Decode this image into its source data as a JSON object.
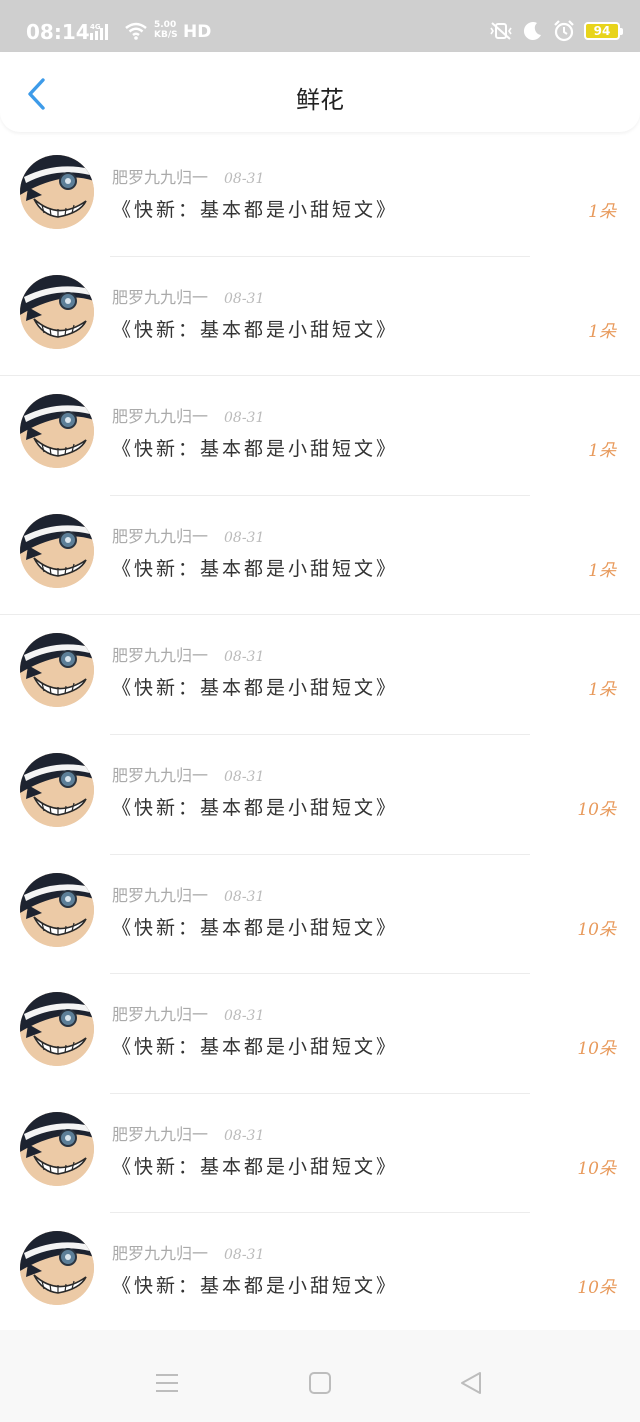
{
  "status_bar": {
    "time": "08:14",
    "network": "4G",
    "speed_value": "5.00",
    "speed_unit": "KB/S",
    "hd": "HD",
    "battery": "94"
  },
  "header": {
    "title": "鲜花"
  },
  "items": [
    {
      "name": "肥罗九九归一",
      "date": "08-31",
      "title": "《快新：基本都是小甜短文》",
      "count": "1朵"
    },
    {
      "name": "肥罗九九归一",
      "date": "08-31",
      "title": "《快新：基本都是小甜短文》",
      "count": "1朵"
    },
    {
      "name": "肥罗九九归一",
      "date": "08-31",
      "title": "《快新：基本都是小甜短文》",
      "count": "1朵"
    },
    {
      "name": "肥罗九九归一",
      "date": "08-31",
      "title": "《快新：基本都是小甜短文》",
      "count": "1朵"
    },
    {
      "name": "肥罗九九归一",
      "date": "08-31",
      "title": "《快新：基本都是小甜短文》",
      "count": "1朵"
    },
    {
      "name": "肥罗九九归一",
      "date": "08-31",
      "title": "《快新：基本都是小甜短文》",
      "count": "10朵"
    },
    {
      "name": "肥罗九九归一",
      "date": "08-31",
      "title": "《快新：基本都是小甜短文》",
      "count": "10朵"
    },
    {
      "name": "肥罗九九归一",
      "date": "08-31",
      "title": "《快新：基本都是小甜短文》",
      "count": "10朵"
    },
    {
      "name": "肥罗九九归一",
      "date": "08-31",
      "title": "《快新：基本都是小甜短文》",
      "count": "10朵"
    },
    {
      "name": "肥罗九九归一",
      "date": "08-31",
      "title": "《快新：基本都是小甜短文》",
      "count": "10朵"
    }
  ],
  "colors": {
    "accent_blue": "#3d9be9",
    "count_orange": "#e89a5c",
    "status_bar_bg": "#cfcfcf"
  },
  "icons": {
    "back": "chevron-left-icon",
    "nav_menu": "menu-icon",
    "nav_home": "square-home-icon",
    "nav_back": "triangle-back-icon"
  }
}
